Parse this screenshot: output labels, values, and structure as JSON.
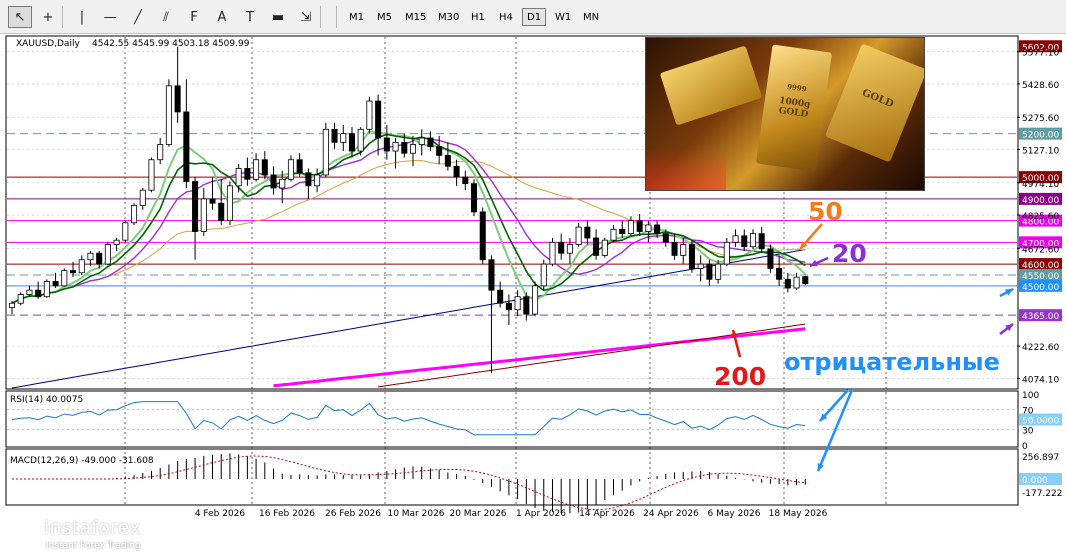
{
  "toolbar": {
    "tools": [
      {
        "icon": "cursor-icon",
        "glyph": "↖"
      },
      {
        "icon": "crosshair-icon",
        "glyph": "+"
      },
      {
        "icon": "vertical-line-icon",
        "glyph": "|"
      },
      {
        "icon": "horizontal-line-icon",
        "glyph": "—"
      },
      {
        "icon": "trendline-icon",
        "glyph": "╱"
      },
      {
        "icon": "equidistant-channel-icon",
        "glyph": "⫽"
      },
      {
        "icon": "fibonacci-icon",
        "glyph": "F"
      },
      {
        "icon": "text-icon",
        "glyph": "A"
      },
      {
        "icon": "text-label-icon",
        "glyph": "T"
      },
      {
        "icon": "rectangle-icon",
        "glyph": "▬"
      },
      {
        "icon": "arrow-shapes-icon",
        "glyph": "⇲"
      }
    ],
    "timeframes": [
      "M1",
      "M5",
      "M15",
      "M30",
      "H1",
      "H4",
      "D1",
      "W1",
      "MN"
    ],
    "active_timeframe": "D1"
  },
  "chart_header": {
    "symbol": "XAUUSD,Daily",
    "ohlc": "4542.55 4545.99 4503.18 4509.99"
  },
  "indicators": {
    "rsi_label": "RSI(14) 40.0075",
    "macd_label": "MACD(12,26,9) -49.000 -31.608",
    "rsi_axis": [
      "100",
      "70",
      "50.0000",
      "30",
      "0"
    ],
    "macd_axis": [
      "256.897",
      "0.000",
      "-177.222"
    ]
  },
  "annotations": {
    "ma50": "50",
    "ma20": "20",
    "ma200": "200",
    "caption": "отрицательные"
  },
  "watermark": {
    "name": "instaforex",
    "tagline": "Instant Forex Trading"
  },
  "photo_stamps": [
    "1000g GOLD",
    "9999",
    "GOLD"
  ],
  "colors": {
    "ma200": "#ff00ff",
    "ma200_ema": "#8b0000",
    "ma_long_blue": "#00008b",
    "ma50": "#d9a03f",
    "ma20": "#9b30d9",
    "ma_fast_dark": "#006400",
    "ma_fast_light": "#7ccd7c",
    "annot_orange": "#f07f1a",
    "annot_purple": "#8b2fd8",
    "annot_red": "#e11919",
    "annot_blue": "#1e90ff"
  },
  "chart_data": {
    "type": "candlestick",
    "title": "XAUUSD,Daily",
    "x_tick_labels": [
      "4 Feb 2026",
      "16 Feb 2026",
      "26 Feb 2026",
      "10 Mar 2026",
      "20 Mar 2026",
      "1 Apr 2026",
      "14 Apr 2026",
      "24 Apr 2026",
      "6 May 2026",
      "18 May 2026"
    ],
    "y_tick_labels": [
      "5577.10",
      "5428.60",
      "5275.60",
      "5127.10",
      "4974.10",
      "4825.60",
      "4672.60",
      "4222.60",
      "4074.10"
    ],
    "ylim": [
      4030,
      5640
    ],
    "levels": [
      {
        "label": "5602.00",
        "value": 5602,
        "color": "#8b0000",
        "style": "tag-only"
      },
      {
        "label": "5200.00",
        "value": 5200,
        "color": "#5f9ea0",
        "style": "dashed"
      },
      {
        "label": "5000.00",
        "value": 5000,
        "color": "#8b0000",
        "style": "solid"
      },
      {
        "label": "4900.00",
        "value": 4900,
        "color": "#8b008b",
        "style": "solid"
      },
      {
        "label": "4800.00",
        "value": 4800,
        "color": "#ee00ee",
        "style": "solid"
      },
      {
        "label": "4700.00",
        "value": 4700,
        "color": "#ee00ee",
        "style": "solid"
      },
      {
        "label": "4600.00",
        "value": 4600,
        "color": "#8b0000",
        "style": "solid"
      },
      {
        "label": "4550.00",
        "value": 4550,
        "color": "#5f9ea0",
        "style": "dashed"
      },
      {
        "label": "4500.00",
        "value": 4500,
        "color": "#1e90ff",
        "style": "solid"
      },
      {
        "label": "4365.00",
        "value": 4365,
        "color": "#9932cc",
        "style": "dashed"
      }
    ],
    "candles": [
      {
        "o": 4400,
        "h": 4430,
        "l": 4370,
        "c": 4420
      },
      {
        "o": 4420,
        "h": 4470,
        "l": 4410,
        "c": 4460
      },
      {
        "o": 4460,
        "h": 4500,
        "l": 4450,
        "c": 4480
      },
      {
        "o": 4480,
        "h": 4520,
        "l": 4440,
        "c": 4450
      },
      {
        "o": 4450,
        "h": 4530,
        "l": 4445,
        "c": 4520
      },
      {
        "o": 4520,
        "h": 4560,
        "l": 4490,
        "c": 4500
      },
      {
        "o": 4500,
        "h": 4580,
        "l": 4495,
        "c": 4570
      },
      {
        "o": 4570,
        "h": 4610,
        "l": 4540,
        "c": 4560
      },
      {
        "o": 4560,
        "h": 4640,
        "l": 4550,
        "c": 4620
      },
      {
        "o": 4620,
        "h": 4660,
        "l": 4590,
        "c": 4650
      },
      {
        "o": 4650,
        "h": 4660,
        "l": 4580,
        "c": 4600
      },
      {
        "o": 4600,
        "h": 4700,
        "l": 4595,
        "c": 4690
      },
      {
        "o": 4690,
        "h": 4720,
        "l": 4660,
        "c": 4710
      },
      {
        "o": 4710,
        "h": 4800,
        "l": 4700,
        "c": 4790
      },
      {
        "o": 4790,
        "h": 4880,
        "l": 4780,
        "c": 4870
      },
      {
        "o": 4870,
        "h": 4950,
        "l": 4850,
        "c": 4940
      },
      {
        "o": 4940,
        "h": 5090,
        "l": 4930,
        "c": 5080
      },
      {
        "o": 5080,
        "h": 5180,
        "l": 5060,
        "c": 5150
      },
      {
        "o": 5150,
        "h": 5450,
        "l": 5140,
        "c": 5420
      },
      {
        "o": 5420,
        "h": 5600,
        "l": 5250,
        "c": 5300
      },
      {
        "o": 5300,
        "h": 5450,
        "l": 4950,
        "c": 4980
      },
      {
        "o": 4980,
        "h": 5000,
        "l": 4620,
        "c": 4750
      },
      {
        "o": 4750,
        "h": 4950,
        "l": 4730,
        "c": 4900
      },
      {
        "o": 4900,
        "h": 5000,
        "l": 4850,
        "c": 4880
      },
      {
        "o": 4880,
        "h": 4990,
        "l": 4780,
        "c": 4800
      },
      {
        "o": 4800,
        "h": 4980,
        "l": 4780,
        "c": 4960
      },
      {
        "o": 4960,
        "h": 5060,
        "l": 4930,
        "c": 5040
      },
      {
        "o": 5040,
        "h": 5090,
        "l": 4960,
        "c": 4990
      },
      {
        "o": 4990,
        "h": 5110,
        "l": 4980,
        "c": 5080
      },
      {
        "o": 5080,
        "h": 5120,
        "l": 4990,
        "c": 5010
      },
      {
        "o": 5010,
        "h": 5050,
        "l": 4920,
        "c": 4950
      },
      {
        "o": 4950,
        "h": 5030,
        "l": 4880,
        "c": 4990
      },
      {
        "o": 4990,
        "h": 5100,
        "l": 4980,
        "c": 5080
      },
      {
        "o": 5080,
        "h": 5110,
        "l": 5000,
        "c": 5020
      },
      {
        "o": 5020,
        "h": 5040,
        "l": 4900,
        "c": 4960
      },
      {
        "o": 4960,
        "h": 5040,
        "l": 4930,
        "c": 5010
      },
      {
        "o": 5010,
        "h": 5250,
        "l": 5000,
        "c": 5220
      },
      {
        "o": 5220,
        "h": 5250,
        "l": 5130,
        "c": 5160
      },
      {
        "o": 5160,
        "h": 5240,
        "l": 5120,
        "c": 5200
      },
      {
        "o": 5200,
        "h": 5230,
        "l": 5090,
        "c": 5120
      },
      {
        "o": 5120,
        "h": 5230,
        "l": 5100,
        "c": 5220
      },
      {
        "o": 5220,
        "h": 5370,
        "l": 5200,
        "c": 5350
      },
      {
        "o": 5350,
        "h": 5380,
        "l": 5100,
        "c": 5180
      },
      {
        "o": 5180,
        "h": 5240,
        "l": 5080,
        "c": 5120
      },
      {
        "o": 5120,
        "h": 5180,
        "l": 5040,
        "c": 5160
      },
      {
        "o": 5160,
        "h": 5200,
        "l": 5090,
        "c": 5110
      },
      {
        "o": 5110,
        "h": 5190,
        "l": 5050,
        "c": 5150
      },
      {
        "o": 5150,
        "h": 5220,
        "l": 5100,
        "c": 5180
      },
      {
        "o": 5180,
        "h": 5210,
        "l": 5120,
        "c": 5140
      },
      {
        "o": 5140,
        "h": 5190,
        "l": 5060,
        "c": 5100
      },
      {
        "o": 5100,
        "h": 5160,
        "l": 5030,
        "c": 5050
      },
      {
        "o": 5050,
        "h": 5080,
        "l": 4960,
        "c": 5000
      },
      {
        "o": 5000,
        "h": 5030,
        "l": 4940,
        "c": 4970
      },
      {
        "o": 4970,
        "h": 4990,
        "l": 4820,
        "c": 4840
      },
      {
        "o": 4840,
        "h": 4860,
        "l": 4600,
        "c": 4620
      },
      {
        "o": 4620,
        "h": 4640,
        "l": 4100,
        "c": 4480
      },
      {
        "o": 4480,
        "h": 4520,
        "l": 4400,
        "c": 4420
      },
      {
        "o": 4420,
        "h": 4460,
        "l": 4320,
        "c": 4390
      },
      {
        "o": 4390,
        "h": 4480,
        "l": 4360,
        "c": 4450
      },
      {
        "o": 4450,
        "h": 4470,
        "l": 4340,
        "c": 4370
      },
      {
        "o": 4370,
        "h": 4520,
        "l": 4360,
        "c": 4500
      },
      {
        "o": 4500,
        "h": 4620,
        "l": 4480,
        "c": 4600
      },
      {
        "o": 4600,
        "h": 4720,
        "l": 4590,
        "c": 4700
      },
      {
        "o": 4700,
        "h": 4740,
        "l": 4620,
        "c": 4650
      },
      {
        "o": 4650,
        "h": 4720,
        "l": 4600,
        "c": 4690
      },
      {
        "o": 4690,
        "h": 4790,
        "l": 4680,
        "c": 4770
      },
      {
        "o": 4770,
        "h": 4800,
        "l": 4690,
        "c": 4720
      },
      {
        "o": 4720,
        "h": 4760,
        "l": 4620,
        "c": 4640
      },
      {
        "o": 4640,
        "h": 4720,
        "l": 4630,
        "c": 4710
      },
      {
        "o": 4710,
        "h": 4780,
        "l": 4700,
        "c": 4760
      },
      {
        "o": 4760,
        "h": 4800,
        "l": 4720,
        "c": 4740
      },
      {
        "o": 4740,
        "h": 4820,
        "l": 4730,
        "c": 4800
      },
      {
        "o": 4800,
        "h": 4830,
        "l": 4730,
        "c": 4750
      },
      {
        "o": 4750,
        "h": 4800,
        "l": 4700,
        "c": 4780
      },
      {
        "o": 4780,
        "h": 4800,
        "l": 4720,
        "c": 4740
      },
      {
        "o": 4740,
        "h": 4760,
        "l": 4680,
        "c": 4700
      },
      {
        "o": 4700,
        "h": 4740,
        "l": 4620,
        "c": 4640
      },
      {
        "o": 4640,
        "h": 4720,
        "l": 4600,
        "c": 4690
      },
      {
        "o": 4690,
        "h": 4710,
        "l": 4560,
        "c": 4580
      },
      {
        "o": 4580,
        "h": 4640,
        "l": 4520,
        "c": 4600
      },
      {
        "o": 4600,
        "h": 4620,
        "l": 4500,
        "c": 4530
      },
      {
        "o": 4530,
        "h": 4620,
        "l": 4510,
        "c": 4600
      },
      {
        "o": 4600,
        "h": 4720,
        "l": 4590,
        "c": 4700
      },
      {
        "o": 4700,
        "h": 4760,
        "l": 4680,
        "c": 4730
      },
      {
        "o": 4730,
        "h": 4760,
        "l": 4660,
        "c": 4680
      },
      {
        "o": 4680,
        "h": 4760,
        "l": 4670,
        "c": 4740
      },
      {
        "o": 4740,
        "h": 4770,
        "l": 4650,
        "c": 4670
      },
      {
        "o": 4670,
        "h": 4690,
        "l": 4560,
        "c": 4580
      },
      {
        "o": 4580,
        "h": 4640,
        "l": 4500,
        "c": 4530
      },
      {
        "o": 4530,
        "h": 4560,
        "l": 4470,
        "c": 4490
      },
      {
        "o": 4490,
        "h": 4560,
        "l": 4480,
        "c": 4540
      },
      {
        "o": 4542.55,
        "h": 4545.99,
        "l": 4503.18,
        "c": 4509.99
      }
    ],
    "series": [
      {
        "name": "",
        "values": []
      }
    ]
  }
}
